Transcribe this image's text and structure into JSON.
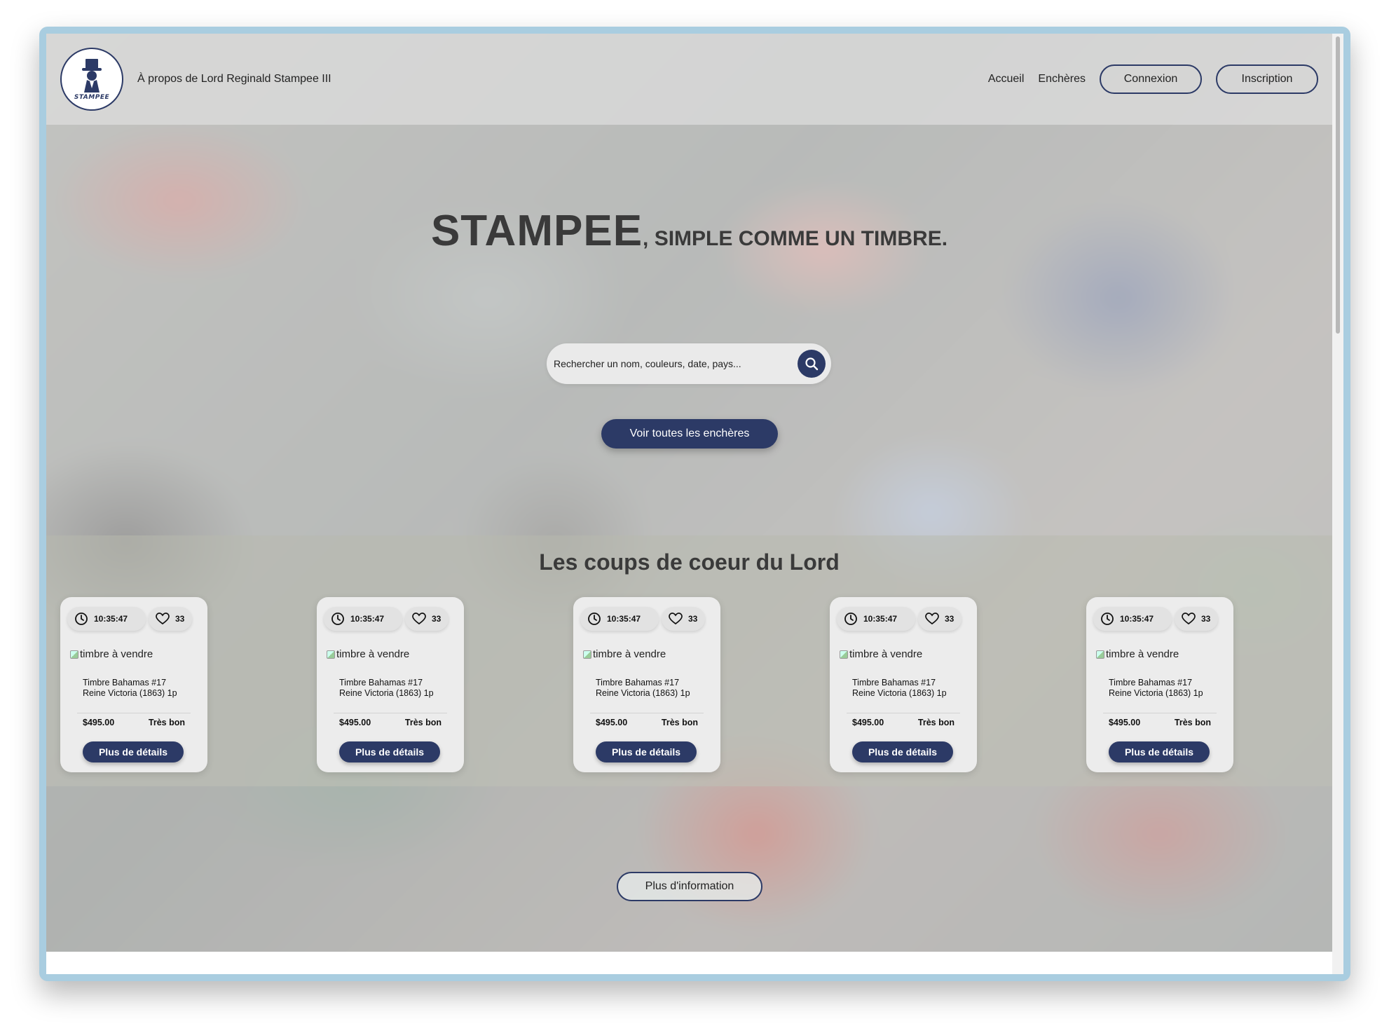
{
  "header": {
    "about_link": "À propos de Lord Reginald Stampee III",
    "logo_text": "STAMPEE",
    "nav": {
      "home": "Accueil",
      "auctions": "Enchères",
      "login": "Connexion",
      "signup": "Inscription"
    }
  },
  "hero": {
    "brand": "STAMPEE",
    "tagline": ", SIMPLE COMME UN TIMBRE.",
    "search_placeholder": "Rechercher un nom, couleurs, date, pays...",
    "cta": "Voir toutes les enchères"
  },
  "favourites": {
    "title": "Les coups de coeur du Lord",
    "cards": [
      {
        "time": "10:35:47",
        "likes": "33",
        "img_alt": "timbre à vendre",
        "name_line1": "Timbre Bahamas #17",
        "name_line2": "Reine Victoria (1863) 1p",
        "price": "$495.00",
        "condition": "Très bon",
        "button": "Plus de détails"
      },
      {
        "time": "10:35:47",
        "likes": "33",
        "img_alt": "timbre à vendre",
        "name_line1": "Timbre Bahamas #17",
        "name_line2": "Reine Victoria (1863) 1p",
        "price": "$495.00",
        "condition": "Très bon",
        "button": "Plus de détails"
      },
      {
        "time": "10:35:47",
        "likes": "33",
        "img_alt": "timbre à vendre",
        "name_line1": "Timbre Bahamas #17",
        "name_line2": "Reine Victoria (1863) 1p",
        "price": "$495.00",
        "condition": "Très bon",
        "button": "Plus de détails"
      },
      {
        "time": "10:35:47",
        "likes": "33",
        "img_alt": "timbre à vendre",
        "name_line1": "Timbre Bahamas #17",
        "name_line2": "Reine Victoria (1863) 1p",
        "price": "$495.00",
        "condition": "Très bon",
        "button": "Plus de détails"
      },
      {
        "time": "10:35:47",
        "likes": "33",
        "img_alt": "timbre à vendre",
        "name_line1": "Timbre Bahamas #17",
        "name_line2": "Reine Victoria (1863) 1p",
        "price": "$495.00",
        "condition": "Très bon",
        "button": "Plus de détails"
      }
    ]
  },
  "more_info": "Plus d'information",
  "colors": {
    "primary": "#2c3a66",
    "frame": "#a9cde0",
    "text": "#3a3a3a"
  },
  "icons": {
    "search": "search-icon",
    "clock": "clock-icon",
    "heart": "heart-icon",
    "logo": "top-hat-gentleman-logo"
  }
}
